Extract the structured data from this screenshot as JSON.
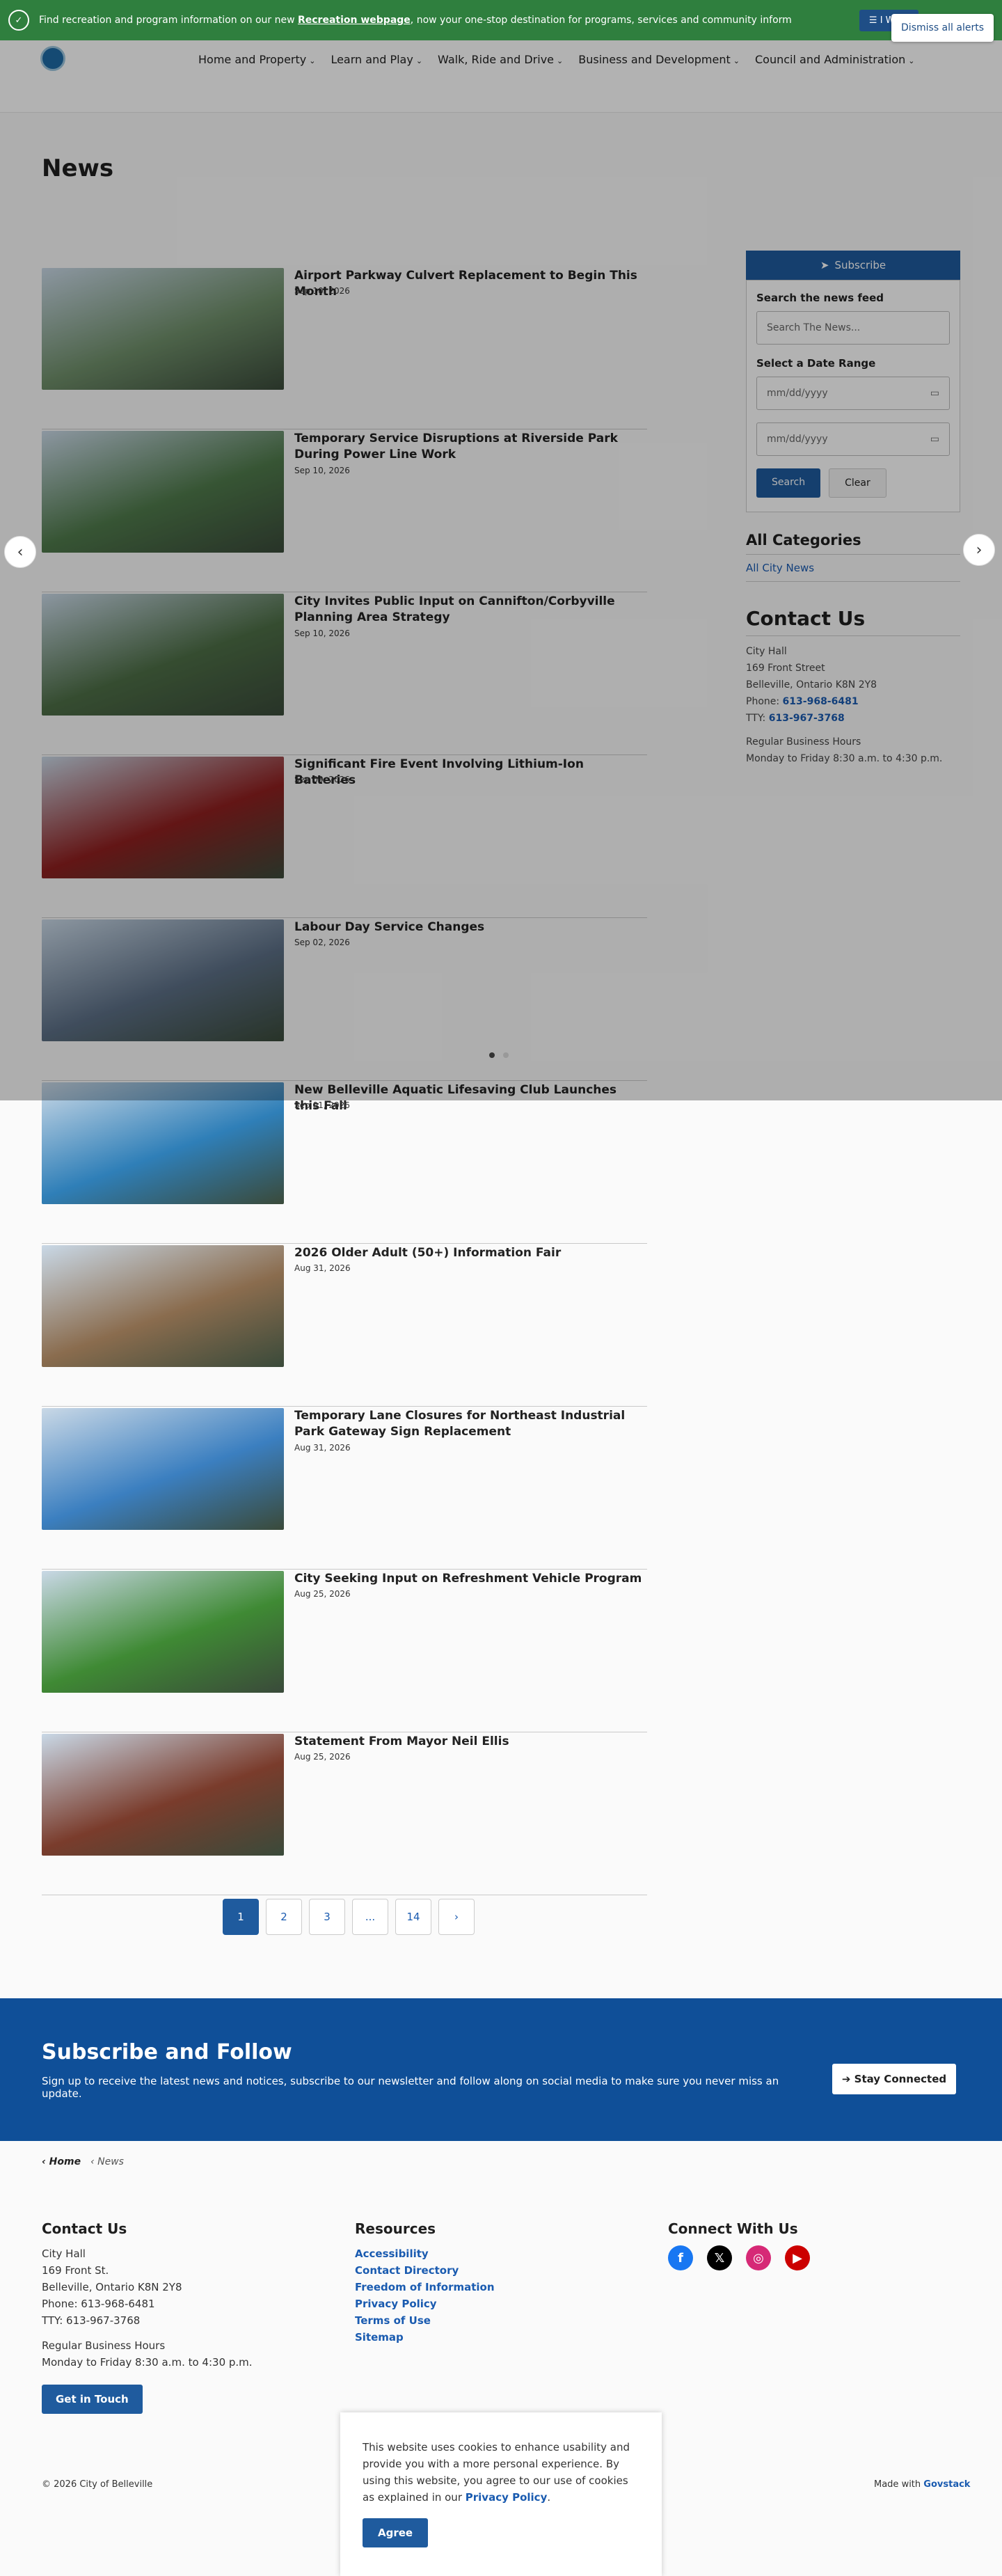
{
  "alert": {
    "text_prefix": "Find recreation and program information on our new ",
    "link": "Recreation webpage",
    "text_suffix": ", now your one-stop destination for programs, services and community inform",
    "want_label": "I Want",
    "dismiss_label": "Dismiss all alerts"
  },
  "nav": [
    {
      "label": "Home and Property"
    },
    {
      "label": "Learn and Play"
    },
    {
      "label": "Walk, Ride and Drive"
    },
    {
      "label": "Business and Development"
    },
    {
      "label": "Council and Administration"
    }
  ],
  "page_title": "News",
  "news": [
    {
      "title": "Airport Parkway Culvert Replacement to Begin This Month",
      "date": "Sep 10, 2026",
      "thumb_color": "#6f8f6a"
    },
    {
      "title": "Temporary Service Disruptions at Riverside Park During Power Line Work",
      "date": "Sep 10, 2026",
      "thumb_color": "#4f7a4b"
    },
    {
      "title": "City Invites Public Input on Cannifton/Corbyville Planning Area Strategy",
      "date": "Sep 10, 2026",
      "thumb_color": "#4d6e46"
    },
    {
      "title": "Significant Fire Event Involving Lithium-Ion Batteries",
      "date": "Sep 09, 2026",
      "thumb_color": "#8e1f1f"
    },
    {
      "title": "Labour Day Service Changes",
      "date": "Sep 02, 2026",
      "thumb_color": "#5c6f86"
    },
    {
      "title": "New Belleville Aquatic Lifesaving Club Launches this Fall",
      "date": "Sep 01, 2026",
      "thumb_color": "#2f7fb8"
    },
    {
      "title": "2026 Older Adult (50+) Information Fair",
      "date": "Aug 31, 2026",
      "thumb_color": "#8a6c4e"
    },
    {
      "title": "Temporary Lane Closures for Northeast Industrial Park Gateway Sign Replacement",
      "date": "Aug 31, 2026",
      "thumb_color": "#3b7fc0"
    },
    {
      "title": "City Seeking Input on Refreshment Vehicle Program",
      "date": "Aug 25, 2026",
      "thumb_color": "#3f8a34"
    },
    {
      "title": "Statement From Mayor Neil Ellis",
      "date": "Aug 25, 2026",
      "thumb_color": "#7a3c2c"
    }
  ],
  "sidebar": {
    "subscribe_label": "Subscribe",
    "search_heading": "Search the news feed",
    "search_placeholder": "Search The News...",
    "date_heading": "Select a Date Range",
    "date_placeholder_1": "mm/dd/yyyy",
    "date_placeholder_2": "mm/dd/yyyy",
    "search_btn": "Search",
    "clear_btn": "Clear",
    "categories_heading": "All Categories",
    "category_link": "All City News",
    "contact_heading": "Contact Us",
    "contact_lines": [
      "City Hall",
      "169 Front Street",
      "Belleville, Ontario K8N 2Y8"
    ],
    "phone_label": "Phone:",
    "phone": "613-968-6481",
    "tty_label": "TTY:",
    "tty": "613-967-3768",
    "hours_label": "Regular Business Hours",
    "hours": "Monday to Friday 8:30 a.m. to 4:30 p.m."
  },
  "pagination": [
    "1",
    "2",
    "3",
    "...",
    "14"
  ],
  "follow": {
    "heading": "Subscribe and Follow",
    "text": "Sign up to receive the latest news and notices, subscribe to our newsletter and follow along on social media to make sure you never miss an update.",
    "button": "Stay Connected"
  },
  "breadcrumb": {
    "home": "Home",
    "current": "News"
  },
  "footer": {
    "contact_heading": "Contact Us",
    "contact_lines": [
      "City Hall",
      "169 Front St.",
      "Belleville, Ontario K8N 2Y8",
      "Phone: 613-968-6481",
      "TTY: 613-967-3768"
    ],
    "hours_label": "Regular Business Hours",
    "hours": "Monday to Friday 8:30 a.m. to 4:30 p.m.",
    "get_btn": "Get in Touch",
    "resources_heading": "Resources",
    "resources": [
      "Accessibility",
      "Contact Directory",
      "Freedom of Information",
      "Privacy Policy",
      "Terms of Use",
      "Sitemap"
    ],
    "connect_heading": "Connect With Us",
    "copyright": "© 2026 City of Belleville",
    "made_with": "Made with",
    "made_brand": "Govstack"
  },
  "cookie": {
    "text": "This website uses cookies to enhance usability and provide you with a more personal experience. By using this website, you agree to our use of cookies as explained in our",
    "link": "Privacy Policy",
    "agree": "Agree"
  }
}
